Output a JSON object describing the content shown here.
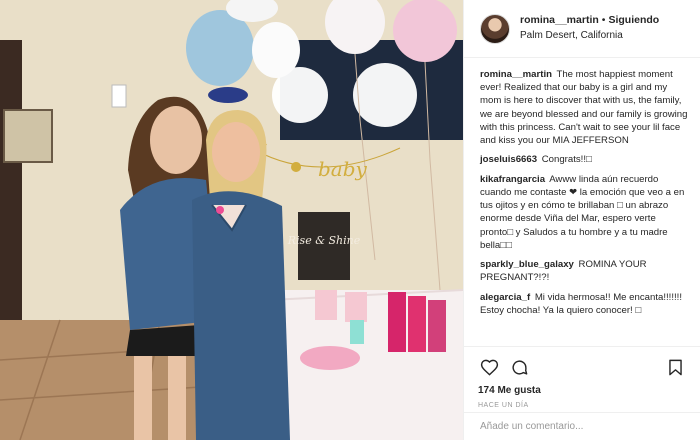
{
  "post": {
    "username": "romina__martin",
    "separator": "•",
    "follow_status": "Siguiendo",
    "location": "Palm Desert, California",
    "photo_banner_text": "baby",
    "photo_sign_text": "Rise & Shine"
  },
  "comments": [
    {
      "user": "romina__martin",
      "text": "The most happiest moment ever! Realized that our baby is a girl and my mom is here to discover that with us, the family, we are beyond blessed and our family is growing with this princess. Can't wait to see your lil face and kiss you our MIA JEFFERSON"
    },
    {
      "user": "joseluis6663",
      "text": "Congrats!!□"
    },
    {
      "user": "kikafrangarcia",
      "text": "Awww linda aún recuerdo cuando me contaste ❤ la emoción que veo a en tus ojitos y en cómo te brillaban □ un abrazo enorme desde Viña del Mar, espero verte pronto□ y Saludos a tu hombre y a tu madre bella□□"
    },
    {
      "user": "sparkly_blue_galaxy",
      "text": "ROMINA YOUR PREGNANT?!?!"
    },
    {
      "user": "alegarcia_f",
      "text": "Mi vida hermosa!! Me encanta!!!!!!! Estoy chocha! Ya la quiero conocer! □"
    }
  ],
  "actions": {
    "like_icon": "heart-icon",
    "comment_icon": "comment-bubble-icon",
    "save_icon": "bookmark-icon",
    "likes_text": "174 Me gusta",
    "time_text": "HACE UN DÍA"
  },
  "add_comment": {
    "placeholder": "Añade un comentario..."
  },
  "colors": {
    "text": "#262626",
    "muted": "#999999",
    "border": "#efefef",
    "wall": "#e7dcc4",
    "denim": "#3c5f86",
    "balloon_pink": "#f4c8d8",
    "tablecloth": "#f7f2f2"
  }
}
